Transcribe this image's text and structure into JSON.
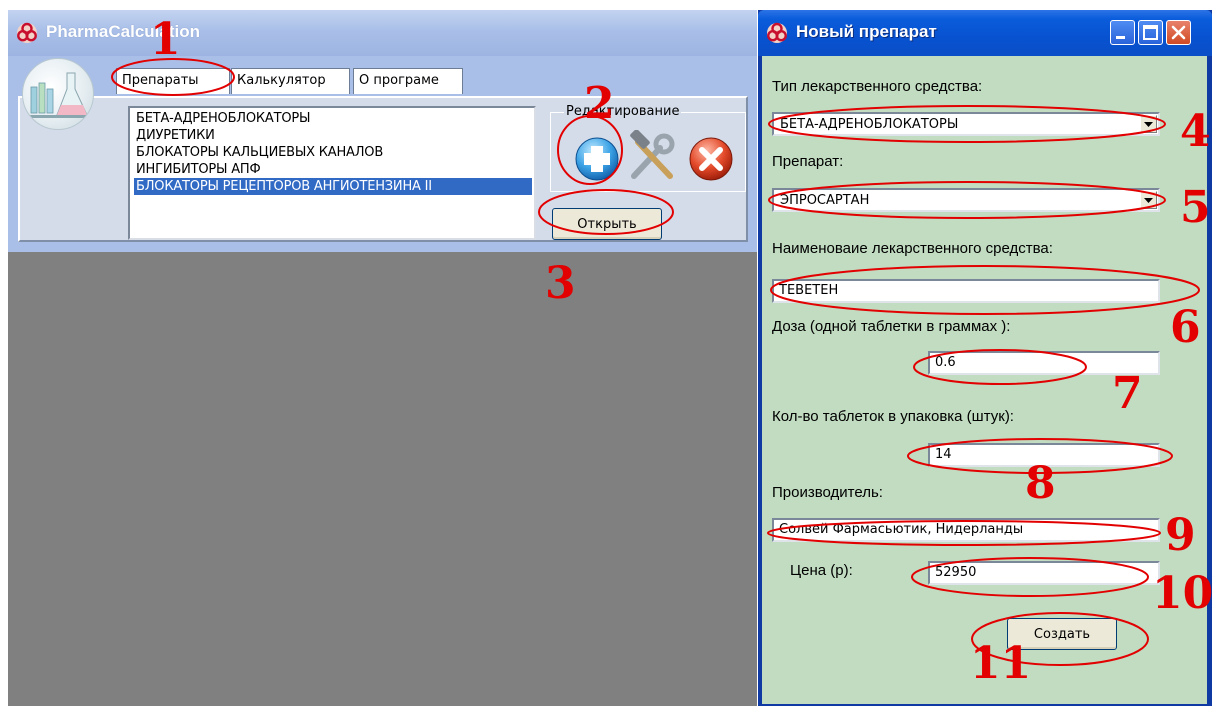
{
  "main_window": {
    "title": "PharmaCalculation",
    "tabs": [
      {
        "label": "Препараты"
      },
      {
        "label": "Калькулятор"
      },
      {
        "label": "О програме"
      }
    ],
    "list_items": [
      {
        "label": "БЕТА-АДРЕНОБЛОКАТОРЫ",
        "selected": false
      },
      {
        "label": "ДИУРЕТИКИ",
        "selected": false
      },
      {
        "label": "БЛОКАТОРЫ КАЛЬЦИЕВЫХ КАНАЛОВ",
        "selected": false
      },
      {
        "label": "ИНГИБИТОРЫ АПФ",
        "selected": false
      },
      {
        "label": "БЛОКАТОРЫ РЕЦЕПТОРОВ АНГИОТЕНЗИНА II",
        "selected": true
      }
    ],
    "edit_group_label": "Редактирование",
    "open_button": "Открыть"
  },
  "dialog": {
    "title": "Новый препарат",
    "type_label": "Тип лекарственного средства:",
    "type_value": "БЕТА-АДРЕНОБЛОКАТОРЫ",
    "drug_label": "Препарат:",
    "drug_value": "ЭПРОСАРТАН",
    "name_label": "Наименоваие  лекарственного средства:",
    "name_value": "ТЕВЕТЕН",
    "dose_label": "Доза (одной таблетки в граммах ):",
    "dose_value": "0.6",
    "count_label": "Кол-во таблеток в упаковка (штук):",
    "count_value": "14",
    "maker_label": "Производитель:",
    "maker_value": "Солвей Фармасьютик, Нидерланды",
    "price_label": "Цена (р):",
    "price_value": "52950",
    "create_button": "Создать"
  },
  "annotations": [
    "1",
    "2",
    "3",
    "4",
    "5",
    "6",
    "7",
    "8",
    "9",
    "10",
    "11"
  ],
  "colors": {
    "annotation_red": "#e20000",
    "dialog_bg": "#c1dcc1",
    "titlebar_blue": "#0a5cdb",
    "selection_blue": "#316ac5"
  }
}
